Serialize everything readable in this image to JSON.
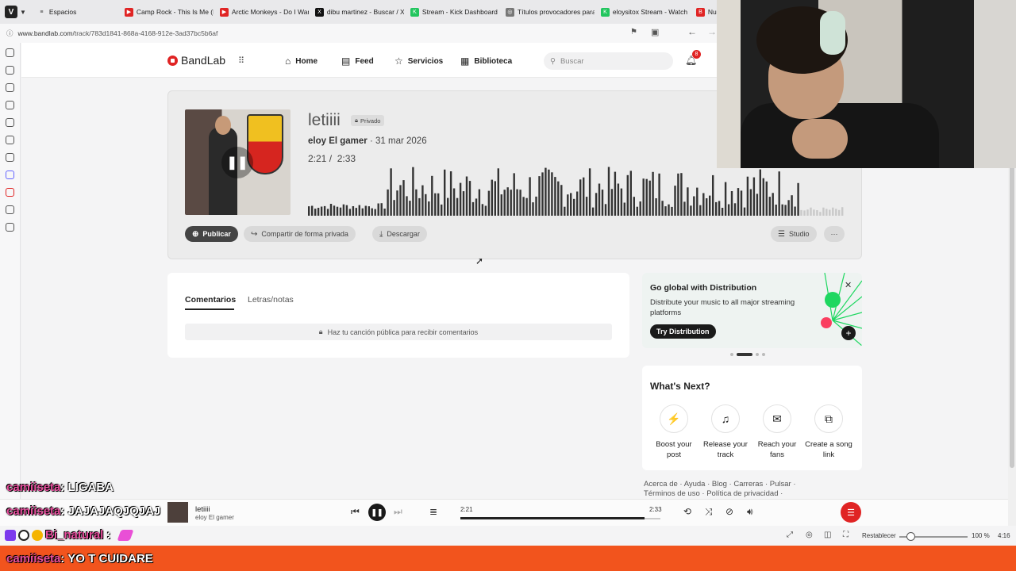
{
  "browser": {
    "tabs": [
      {
        "label": "Espacios",
        "color": "#444",
        "glyph": "≡"
      },
      {
        "label": "Camp Rock - This Is Me (Ka",
        "color": "#e02424",
        "glyph": "▶"
      },
      {
        "label": "Arctic Monkeys - Do I Wan",
        "color": "#e02424",
        "glyph": "▶"
      },
      {
        "label": "dibu martinez - Buscar / X",
        "color": "#111",
        "glyph": "X"
      },
      {
        "label": "Stream - Kick Dashboard",
        "color": "#22c55e",
        "glyph": "K"
      },
      {
        "label": "Títulos provocadores para",
        "color": "#777",
        "glyph": "◎"
      },
      {
        "label": "eloysitox Stream - Watch L",
        "color": "#22c55e",
        "glyph": "K"
      },
      {
        "label": "Nuevo proyect",
        "color": "#e02424",
        "glyph": "B"
      }
    ],
    "url_host": "www.bandlab.com",
    "url_path": "/track/783d1841-868a-4168-912e-3ad37bc5b6af"
  },
  "nav": {
    "home": "Home",
    "feed": "Feed",
    "services": "Servicios",
    "library": "Biblioteca",
    "search_placeholder": "Buscar",
    "notif_count": "8",
    "logo": "BandLab"
  },
  "track": {
    "title": "letiiii",
    "privacy": "Privado",
    "artist": "eloy El gamer",
    "date": "· 31 mar 2026",
    "current_time": "2:21",
    "total_time": "2:33",
    "progress": 0.92,
    "publish": "Publicar",
    "share": "Compartir de forma privada",
    "download": "Descargar",
    "studio": "Studio"
  },
  "comments": {
    "tab_comments": "Comentarios",
    "tab_lyrics": "Letras/notas",
    "message": "Haz tu canción pública para recibir comentarios"
  },
  "promo": {
    "title": "Go global with Distribution",
    "desc": "Distribute your music to all major streaming platforms",
    "button": "Try Distribution",
    "accent": "#1ed760"
  },
  "whats_next": {
    "title": "What's Next?",
    "items": [
      {
        "label": "Boost your post",
        "icon": "boost-icon",
        "glyph": "⚡"
      },
      {
        "label": "Release your track",
        "icon": "release-icon",
        "glyph": "♫"
      },
      {
        "label": "Reach your fans",
        "icon": "mail-icon",
        "glyph": "✉"
      },
      {
        "label": "Create a song link",
        "icon": "link-icon",
        "glyph": "⧉"
      }
    ]
  },
  "footer": {
    "line1": "Acerca de · Ayuda · Blog · Carreras · Pulsar ·",
    "line2": "Términos de uso · Política de privacidad ·"
  },
  "player": {
    "title": "letiiii",
    "artist": "eloy El gamer",
    "current": "2:21",
    "total": "2:33",
    "progress": 0.92
  },
  "statusbar": {
    "reset": "Restablecer",
    "zoom": "100 %",
    "zoom_level": 0.16,
    "clock": "4:16"
  },
  "chat": [
    {
      "user": "camiiseta",
      "msg": ": LIGABA"
    },
    {
      "user": "camiiseta",
      "msg": ": JAJAJAQJQJAJ"
    },
    {
      "user": "Bi_natural",
      "msg": ":"
    },
    {
      "user": "camiiseta",
      "msg": ": YO T CUIDARE"
    }
  ],
  "colors": {
    "brand": "#e02424",
    "overlay_bar": "#f2541d",
    "chat_user": "#e94f9f"
  }
}
